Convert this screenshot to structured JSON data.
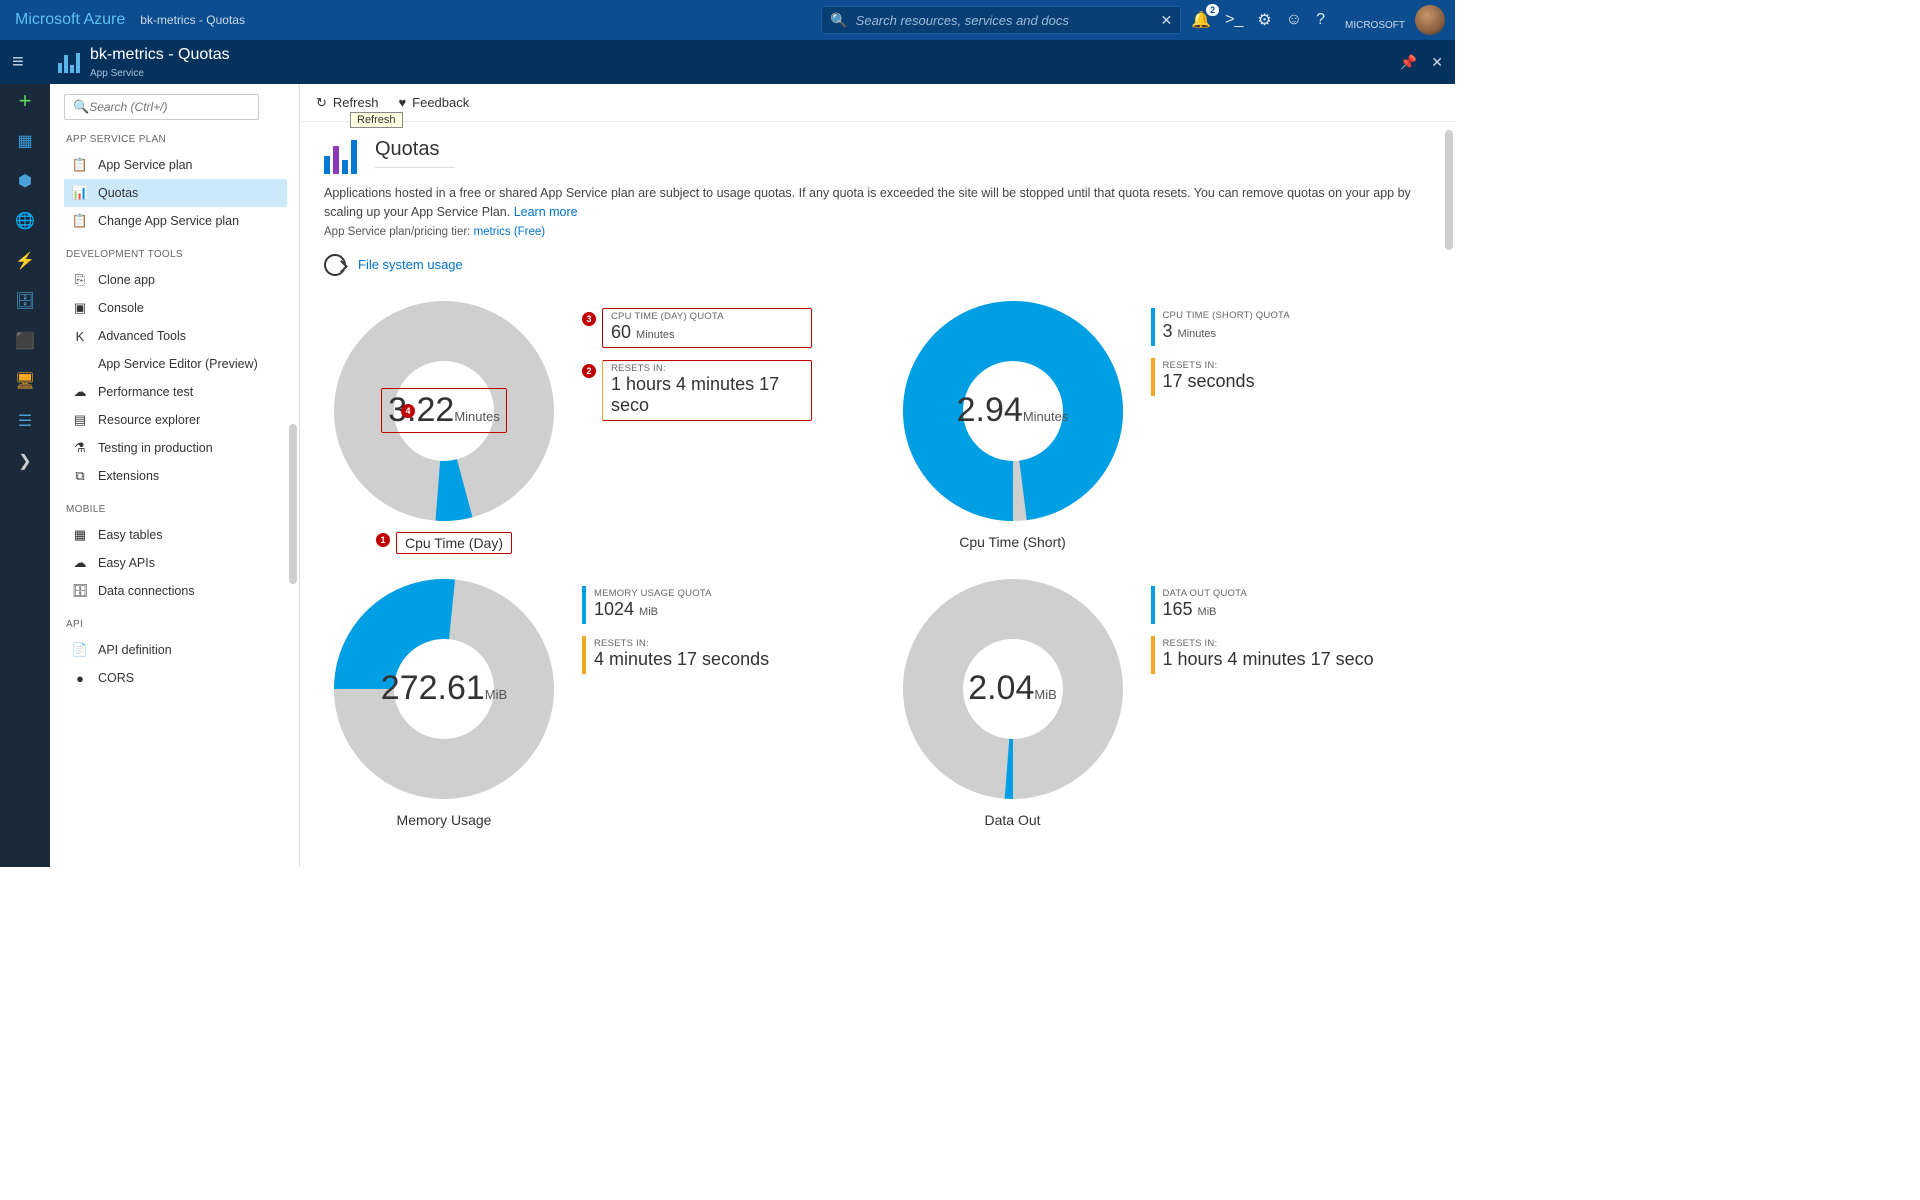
{
  "header": {
    "brand": "Microsoft Azure",
    "breadcrumb": "bk-metrics - Quotas",
    "search_placeholder": "Search resources, services and docs",
    "notification_count": "2",
    "tenant": "MICROSOFT"
  },
  "blade": {
    "title": "bk-metrics - Quotas",
    "subtitle": "App Service"
  },
  "sidebar": {
    "search_placeholder": "Search (Ctrl+/)",
    "sections": [
      {
        "title": "APP SERVICE PLAN",
        "items": [
          {
            "label": "App Service plan",
            "icon": "📋"
          },
          {
            "label": "Quotas",
            "icon": "📊",
            "active": true
          },
          {
            "label": "Change App Service plan",
            "icon": "📋"
          }
        ]
      },
      {
        "title": "DEVELOPMENT TOOLS",
        "items": [
          {
            "label": "Clone app",
            "icon": "⎘"
          },
          {
            "label": "Console",
            "icon": "▣"
          },
          {
            "label": "Advanced Tools",
            "icon": "K"
          },
          {
            "label": "App Service Editor (Preview)",
            "icon": "</>"
          },
          {
            "label": "Performance test",
            "icon": "☁"
          },
          {
            "label": "Resource explorer",
            "icon": "▤"
          },
          {
            "label": "Testing in production",
            "icon": "⚗"
          },
          {
            "label": "Extensions",
            "icon": "⧉"
          }
        ]
      },
      {
        "title": "MOBILE",
        "items": [
          {
            "label": "Easy tables",
            "icon": "▦"
          },
          {
            "label": "Easy APIs",
            "icon": "☁"
          },
          {
            "label": "Data connections",
            "icon": "🗄"
          }
        ]
      },
      {
        "title": "API",
        "items": [
          {
            "label": "API definition",
            "icon": "📄"
          },
          {
            "label": "CORS",
            "icon": "●"
          }
        ]
      }
    ]
  },
  "toolbar": {
    "refresh": "Refresh",
    "feedback": "Feedback",
    "tooltip": "Refresh"
  },
  "page": {
    "title": "Quotas",
    "desc_pre": "Applications hosted in a free or shared App Service plan are subject to usage quotas. If any quota is exceeded the site will be stopped until that quota resets. You can remove quotas on your app by scaling up your App Service Plan. ",
    "learn_more": "Learn more",
    "tier_pre": "App Service plan/pricing tier: ",
    "tier_link": "metrics (Free)",
    "fs_usage": "File system usage"
  },
  "chart_data": [
    {
      "type": "pie",
      "title": "Cpu Time (Day)",
      "value": "3.22",
      "unit": "Minutes",
      "used": 3.22,
      "total": 60,
      "percent_used": 5.4,
      "quota_label": "CPU TIME (DAY) QUOTA",
      "quota_value": "60",
      "quota_unit": "Minutes",
      "resets_label": "RESETS IN:",
      "resets_value": "1 hours 4 minutes 17 seco",
      "callouts": {
        "chart_num": "4",
        "label_num": "1",
        "quota_num": "3",
        "resets_num": "2"
      }
    },
    {
      "type": "pie",
      "title": "Cpu Time (Short)",
      "value": "2.94",
      "unit": "Minutes",
      "used": 2.94,
      "total": 3,
      "percent_used": 98,
      "quota_label": "CPU TIME (SHORT) QUOTA",
      "quota_value": "3",
      "quota_unit": "Minutes",
      "resets_label": "RESETS IN:",
      "resets_value": "17 seconds"
    },
    {
      "type": "pie",
      "title": "Memory Usage",
      "value": "272.61",
      "unit": "MiB",
      "used": 272.61,
      "total": 1024,
      "percent_used": 26.6,
      "quota_label": "MEMORY USAGE QUOTA",
      "quota_value": "1024",
      "quota_unit": "MiB",
      "resets_label": "RESETS IN:",
      "resets_value": "4 minutes 17 seconds"
    },
    {
      "type": "pie",
      "title": "Data Out",
      "value": "2.04",
      "unit": "MiB",
      "used": 2.04,
      "total": 165,
      "percent_used": 1.2,
      "quota_label": "DATA OUT QUOTA",
      "quota_value": "165",
      "quota_unit": "MiB",
      "resets_label": "RESETS IN:",
      "resets_value": "1 hours 4 minutes 17 seco"
    }
  ]
}
